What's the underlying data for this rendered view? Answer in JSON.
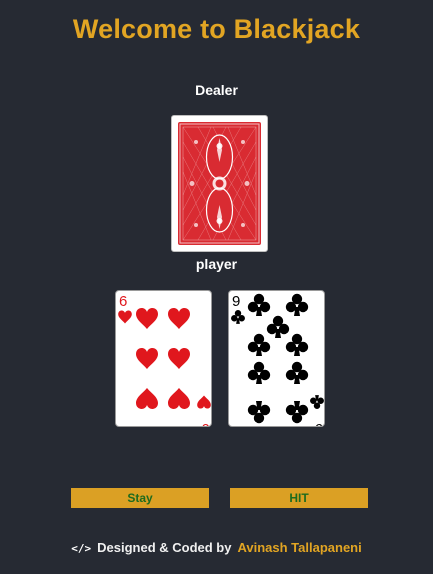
{
  "header": {
    "title": "Welcome to Blackjack"
  },
  "dealer": {
    "label": "Dealer",
    "cards": [
      {
        "face": "back",
        "back_color": "#d92b32"
      }
    ]
  },
  "player": {
    "label": "player",
    "cards": [
      {
        "rank": "6",
        "suit": "hearts",
        "suit_symbol": "♥",
        "color": "#e0171d"
      },
      {
        "rank": "9",
        "suit": "clubs",
        "suit_symbol": "♣",
        "color": "#000000"
      }
    ]
  },
  "controls": {
    "stay_label": "Stay",
    "hit_label": "HIT"
  },
  "footer": {
    "icon": "code-icon",
    "icon_glyph": "</>",
    "credit": "Designed & Coded by",
    "author": "Avinash Tallapaneni"
  },
  "colors": {
    "background": "#262a33",
    "accent": "#e2a523",
    "button_text": "#1e6b1e"
  }
}
